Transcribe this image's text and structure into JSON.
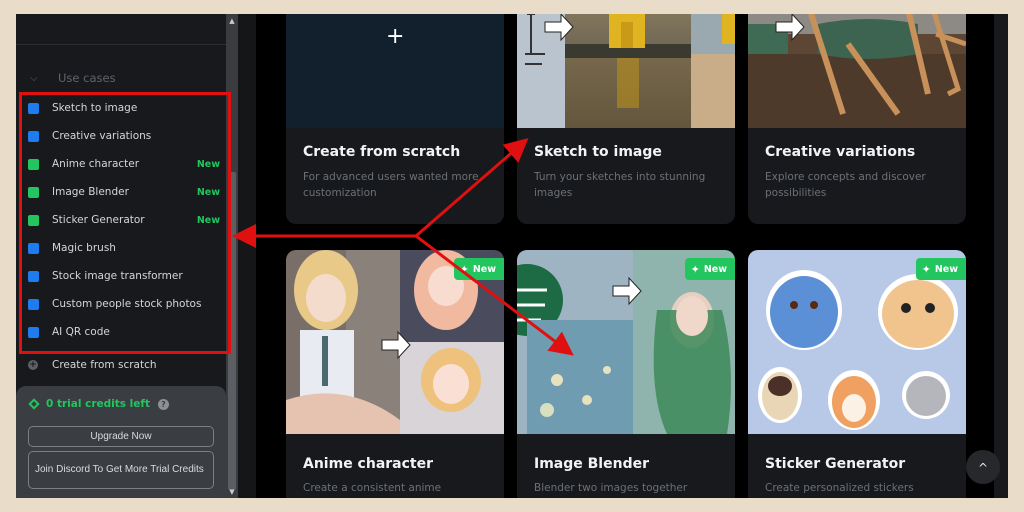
{
  "sidebar": {
    "section_label": "Use cases",
    "items": [
      {
        "label": "Sketch to image",
        "color": "#1e7cf0",
        "badge": ""
      },
      {
        "label": "Creative variations",
        "color": "#1e7cf0",
        "badge": ""
      },
      {
        "label": "Anime character",
        "color": "#22c55e",
        "badge": "New"
      },
      {
        "label": "Image Blender",
        "color": "#22c55e",
        "badge": "New"
      },
      {
        "label": "Sticker Generator",
        "color": "#22c55e",
        "badge": "New"
      },
      {
        "label": "Magic brush",
        "color": "#1e7cf0",
        "badge": ""
      },
      {
        "label": "Stock image transformer",
        "color": "#1e7cf0",
        "badge": ""
      },
      {
        "label": "Custom people stock photos",
        "color": "#1e7cf0",
        "badge": ""
      },
      {
        "label": "AI QR code",
        "color": "#1e7cf0",
        "badge": ""
      }
    ],
    "create_from_scratch": "Create from scratch",
    "credits": {
      "text": "0 trial credits left",
      "help": "?",
      "upgrade_label": "Upgrade Now",
      "discord_label": "Join Discord To Get More Trial Credits"
    }
  },
  "cards": [
    {
      "title": "Create from scratch",
      "desc": "For advanced users wanted more customization",
      "badge": "",
      "icon": "+"
    },
    {
      "title": "Sketch to image",
      "desc": "Turn your sketches into stunning images",
      "badge": ""
    },
    {
      "title": "Creative variations",
      "desc": "Explore concepts and discover possibilities",
      "badge": ""
    },
    {
      "title": "Anime character",
      "desc": "Create a consistent anime",
      "badge": "New"
    },
    {
      "title": "Image Blender",
      "desc": "Blender two images together",
      "badge": "New"
    },
    {
      "title": "Sticker Generator",
      "desc": "Create personalized stickers",
      "badge": "New"
    }
  ],
  "scroll_top_icon": "^",
  "colors": {
    "accent_green": "#22c55e",
    "accent_blue": "#1e7cf0",
    "annotation_red": "#e01010"
  }
}
